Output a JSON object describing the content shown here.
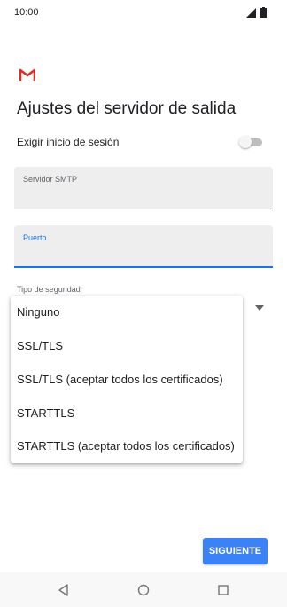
{
  "status_bar": {
    "time": "10:00",
    "icons": [
      "signal-icon",
      "battery-icon"
    ]
  },
  "app": {
    "logo_icon": "gmail-icon",
    "brand_color": "#d93025"
  },
  "screen": {
    "title": "Ajustes del servidor de salida",
    "login_required": {
      "label": "Exigir inicio de sesión",
      "enabled": false
    },
    "fields": {
      "smtp_server": {
        "label": "Servidor SMTP",
        "value": ""
      },
      "port": {
        "label": "Puerto",
        "value": "",
        "focused": true
      }
    },
    "security_type": {
      "label": "Tipo de seguridad"
    },
    "security_menu": {
      "options": [
        "Ninguno",
        "SSL/TLS",
        "SSL/TLS (aceptar todos los certificados)",
        "STARTTLS",
        "STARTTLS (aceptar todos los certificados)"
      ]
    },
    "next_button": {
      "label": "SIGUIENTE",
      "color": "#3b82f6"
    }
  },
  "nav_bar": {
    "buttons": [
      "back-icon",
      "home-icon",
      "recents-icon"
    ]
  }
}
